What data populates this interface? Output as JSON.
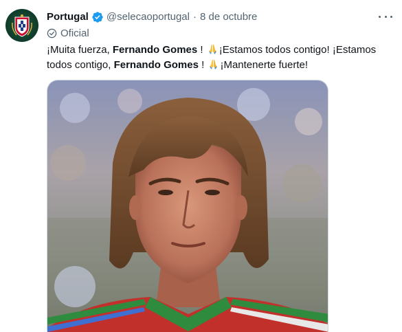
{
  "author": {
    "name": "Portugal",
    "handle": "@selecaoportugal",
    "separator": "·",
    "date": "8 de octubre",
    "label": "Oficial",
    "verified": true
  },
  "tweet": {
    "segments": [
      {
        "text": "¡Muita fuerza, ",
        "bold": false
      },
      {
        "text": "Fernando Gomes",
        "bold": true
      },
      {
        "text": " ! ",
        "bold": false
      },
      {
        "text": "folded-hands-emoji",
        "emoji": true
      },
      {
        "text": "¡Estamos todos contigo! ¡Estamos todos contigo, ",
        "bold": false
      },
      {
        "text": "Fernando Gomes",
        "bold": true
      },
      {
        "text": " ! ",
        "bold": false
      },
      {
        "text": "folded-hands-emoji",
        "emoji": true
      },
      {
        "text": "¡Mantenerte fuerte!",
        "bold": false
      }
    ]
  },
  "icons": {
    "verified": "verified-badge-icon",
    "official": "official-check-circle-icon",
    "more": "more-options-icon",
    "avatar": "portugal-federation-crest"
  },
  "colors": {
    "text_primary": "#0f1419",
    "text_secondary": "#536471",
    "verified_blue": "#1d9bf0",
    "avatar_green": "#0f3b2a",
    "crest_red": "#c8102e"
  }
}
